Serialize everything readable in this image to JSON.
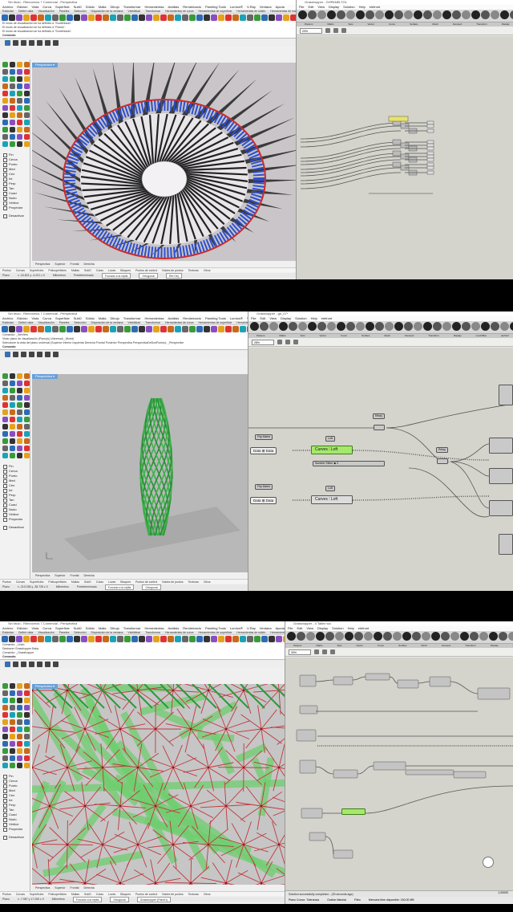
{
  "rhino": {
    "menu_en": [
      "Archivo",
      "Edición",
      "Vista",
      "Curva",
      "Superficie",
      "SubD",
      "Sólido",
      "Malla",
      "Dibujo",
      "Transformar",
      "Herramientas",
      "Análisis",
      "Renderizado",
      "Paneling Tools",
      "Lumion®",
      "V-Ray",
      "Ventana",
      "Ayuda"
    ],
    "tabs": [
      "Estándar",
      "Definir vista",
      "Visualización",
      "Paneles",
      "Selección",
      "Disposición de la ventana",
      "Visibilidad",
      "Transformar",
      "Herramientas de curva",
      "Herramientas de superficie",
      "Herramientas de sólido",
      "Herramientas de malla",
      "Render",
      "Dibujo",
      "Novedades en V7"
    ],
    "osnaps": [
      "Fin",
      "Cerca",
      "Punto",
      "Med",
      "Cen",
      "Int",
      "Perp",
      "Tan",
      "Cuad",
      "Nodo",
      "Vértice",
      "Proyectar"
    ],
    "desactivar": "Desactivar",
    "view_tabs": [
      "Perspectiva",
      "Superior",
      "Frontal",
      "Derecha"
    ],
    "osnap_bar": [
      "Puntos",
      "Curvas",
      "Superficies",
      "Polisuperficies",
      "Mallas",
      "SubD",
      "Cotas",
      "Luces",
      "Bloques",
      "Puntos de control",
      "Nubes de puntos",
      "Texturas",
      "Otros"
    ],
    "status": {
      "unit": "Milímetros",
      "layer": "Predeterminado",
      "snap": "Forzado a la rejilla",
      "ortho": "Ortogonal",
      "planar": "Plano",
      "osnap": "Ref.Obj",
      "smarttrack": "SmartTrack",
      "gumball": "Gumball"
    }
  },
  "gh": {
    "menu": [
      "File",
      "Edit",
      "View",
      "Display",
      "Solution",
      "Help",
      "elefront"
    ],
    "cats": [
      "Params",
      "Maths",
      "Sets",
      "Vector",
      "Curve",
      "Surface",
      "Mesh",
      "Intersect",
      "Transform",
      "Display",
      "LunchBox",
      "elefront"
    ],
    "title1": "Grasshopper - GHPANELTOL",
    "title3": "Grasshopper - 4 Taller.nuc"
  },
  "panel1": {
    "window_title": "Sin título - Rhinoceros 7 Comercial - Perspectiva",
    "cmd_lines": [
      "El modo de visualización se ha definido a \"Sombreado\".",
      "El modo de visualización se ha definido a \"Rótulo\".",
      "El modo de visualización se ha definido a \"Sombreado\"."
    ],
    "prompt": "Comando:",
    "viewport_label": "Perspectiva ▾",
    "coords": "x -16.601  y -4.021  z 0",
    "zoom": "20%",
    "gh_mark": "GHEPANELTOL"
  },
  "panel2": {
    "window_title": "Sin título - Rhinoceros 7 Comercial - Perspectiva",
    "cmd_lines": [
      "Comando: _SetView",
      "Vista: plano de visualización (Plano(s)  Universal)  _World)",
      "Seleccione la vista del plano universal (Superior  Inferior  Izquierda  Derecha  Frontal  Posterior  Perspectiva  PerspectivaDeDosPuntos): _Perspective"
    ],
    "prompt": "Comando:",
    "viewport_label": "Perspectiva ▾",
    "coords": "x -210.036  y -38.726  z 0",
    "zoom": "28%",
    "gh_title": "Grasshopper - gh_07*",
    "nodes": {
      "relay": "Relay",
      "flip1": "Flip Matrix",
      "flip2": "Flip Matrix",
      "loft1": "Loft",
      "loft2": "Loft",
      "data": "Data",
      "curves": "Curves",
      "options": "Options",
      "loft_out": "Loft",
      "slider_label": "Number Slider",
      "slider_value": "◆ 3",
      "relay2": "Relay"
    }
  },
  "panel3": {
    "window_title": "Sin título - Rhinoceros 7 Comercial - Perspectiva",
    "cmd_lines": [
      "Comando: _Undo",
      "Deshacer Grasshopper Baby",
      "Comando: _Grasshopper"
    ],
    "prompt": "Comando:",
    "viewport_label": "Perspectiva ▾",
    "coords": "x -7.987  y 17.265  z 0",
    "zoom": "30%",
    "gh_status": "Solution successfully completed... (30 seconds ago)",
    "statusbar_tail": [
      "Grasshopper (Panel1)",
      "Plano  Cursor. Tolerancia",
      "Grabar historial",
      "Filtro",
      "Memoria libre disponible: 150.00 MB"
    ],
    "gh_coord": "1,00000",
    "gh_right_label": "el_baher.nuc"
  }
}
